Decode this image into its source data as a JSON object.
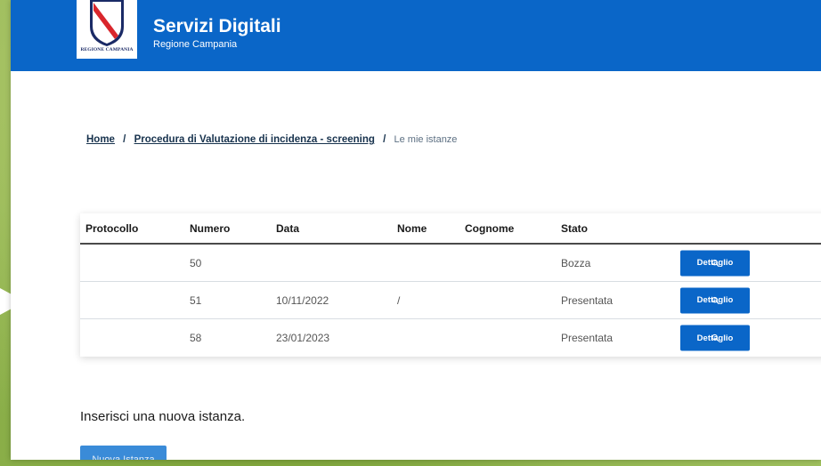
{
  "header": {
    "title": "Servizi Digitali",
    "subtitle": "Regione Campania",
    "logo_text": "REGIONE CAMPANIA"
  },
  "breadcrumb": {
    "items": [
      "Home",
      "Procedura di Valutazione di incidenza - screening"
    ],
    "separator": "/",
    "current": "Le mie istanze"
  },
  "table": {
    "headers": [
      "Protocollo",
      "Numero",
      "Data",
      "Nome",
      "Cognome",
      "Stato"
    ],
    "rows": [
      {
        "protocollo": "",
        "numero": "50",
        "data": "",
        "nome": "",
        "cognome": "",
        "stato": "Bozza",
        "action": "Dettaglio"
      },
      {
        "protocollo": "",
        "numero": "51",
        "data": "10/11/2022",
        "nome": "/",
        "cognome": "",
        "stato": "Presentata",
        "action": "Dettaglio"
      },
      {
        "protocollo": "",
        "numero": "58",
        "data": "23/01/2023",
        "nome": "",
        "cognome": "",
        "stato": "Presentata",
        "action": "Dettaglio"
      }
    ]
  },
  "new_instance": {
    "label": "Inserisci una nuova istanza.",
    "button": "Nuova Istanza"
  },
  "colors": {
    "primary": "#0a66c8",
    "frame": "#8fb24a"
  }
}
